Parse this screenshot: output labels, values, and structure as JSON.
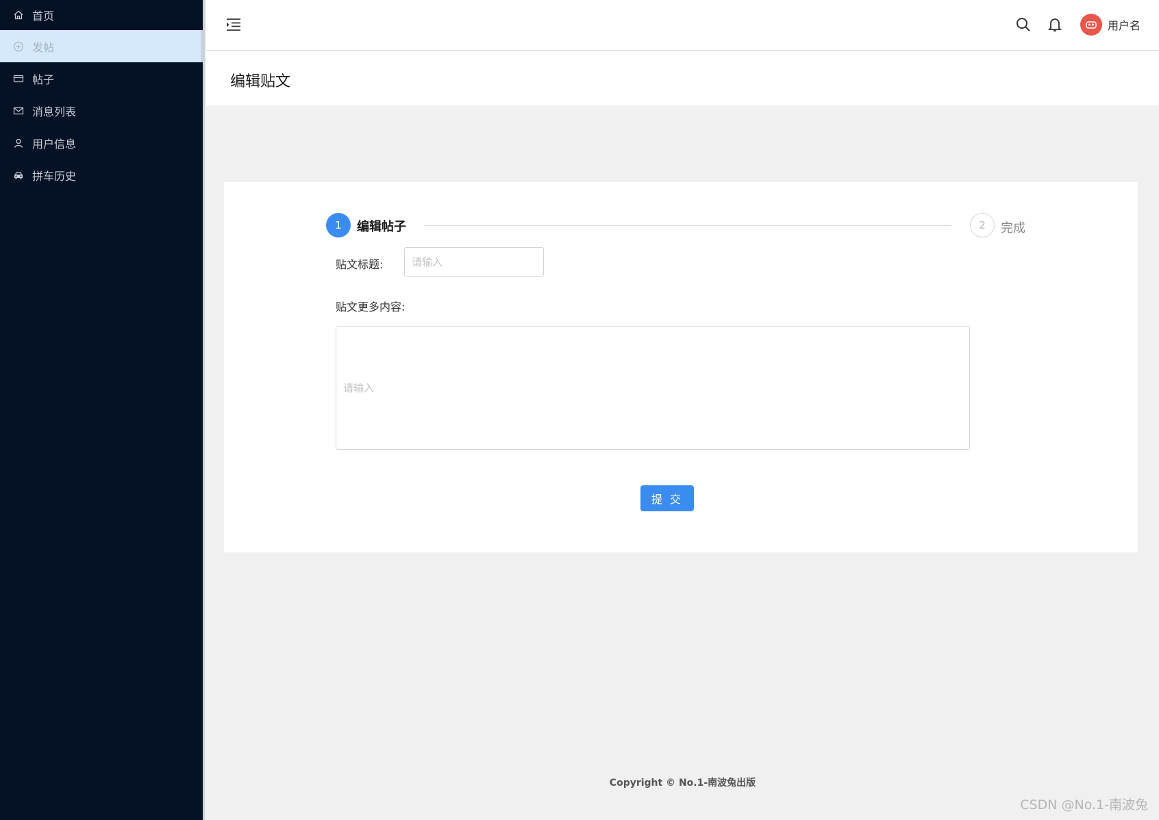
{
  "sidebar": {
    "items": [
      {
        "label": "首页",
        "icon": "home-icon"
      },
      {
        "label": "发帖",
        "icon": "plus-circle-icon",
        "active": true
      },
      {
        "label": "帖子",
        "icon": "card-icon"
      },
      {
        "label": "消息列表",
        "icon": "mail-icon"
      },
      {
        "label": "用户信息",
        "icon": "user-icon"
      },
      {
        "label": "拼车历史",
        "icon": "car-icon"
      }
    ]
  },
  "header": {
    "username": "用户名"
  },
  "page": {
    "title": "编辑贴文"
  },
  "steps": {
    "step1_number": "1",
    "step1_label": "编辑帖子",
    "step2_number": "2",
    "step2_label": "完成"
  },
  "form": {
    "title_label": "贴文标题:",
    "title_placeholder": "请输入",
    "content_label": "贴文更多内容:",
    "content_placeholder": "请输入",
    "submit_label": "提 交"
  },
  "footer": {
    "copyright": "Copyright © No.1-南波兔出版"
  },
  "watermark": "CSDN @No.1-南波兔",
  "colors": {
    "sidebar_bg": "#051226",
    "active_item_bg": "#d5e9fb",
    "primary": "#3b8cf0",
    "avatar": "#e8574c"
  }
}
